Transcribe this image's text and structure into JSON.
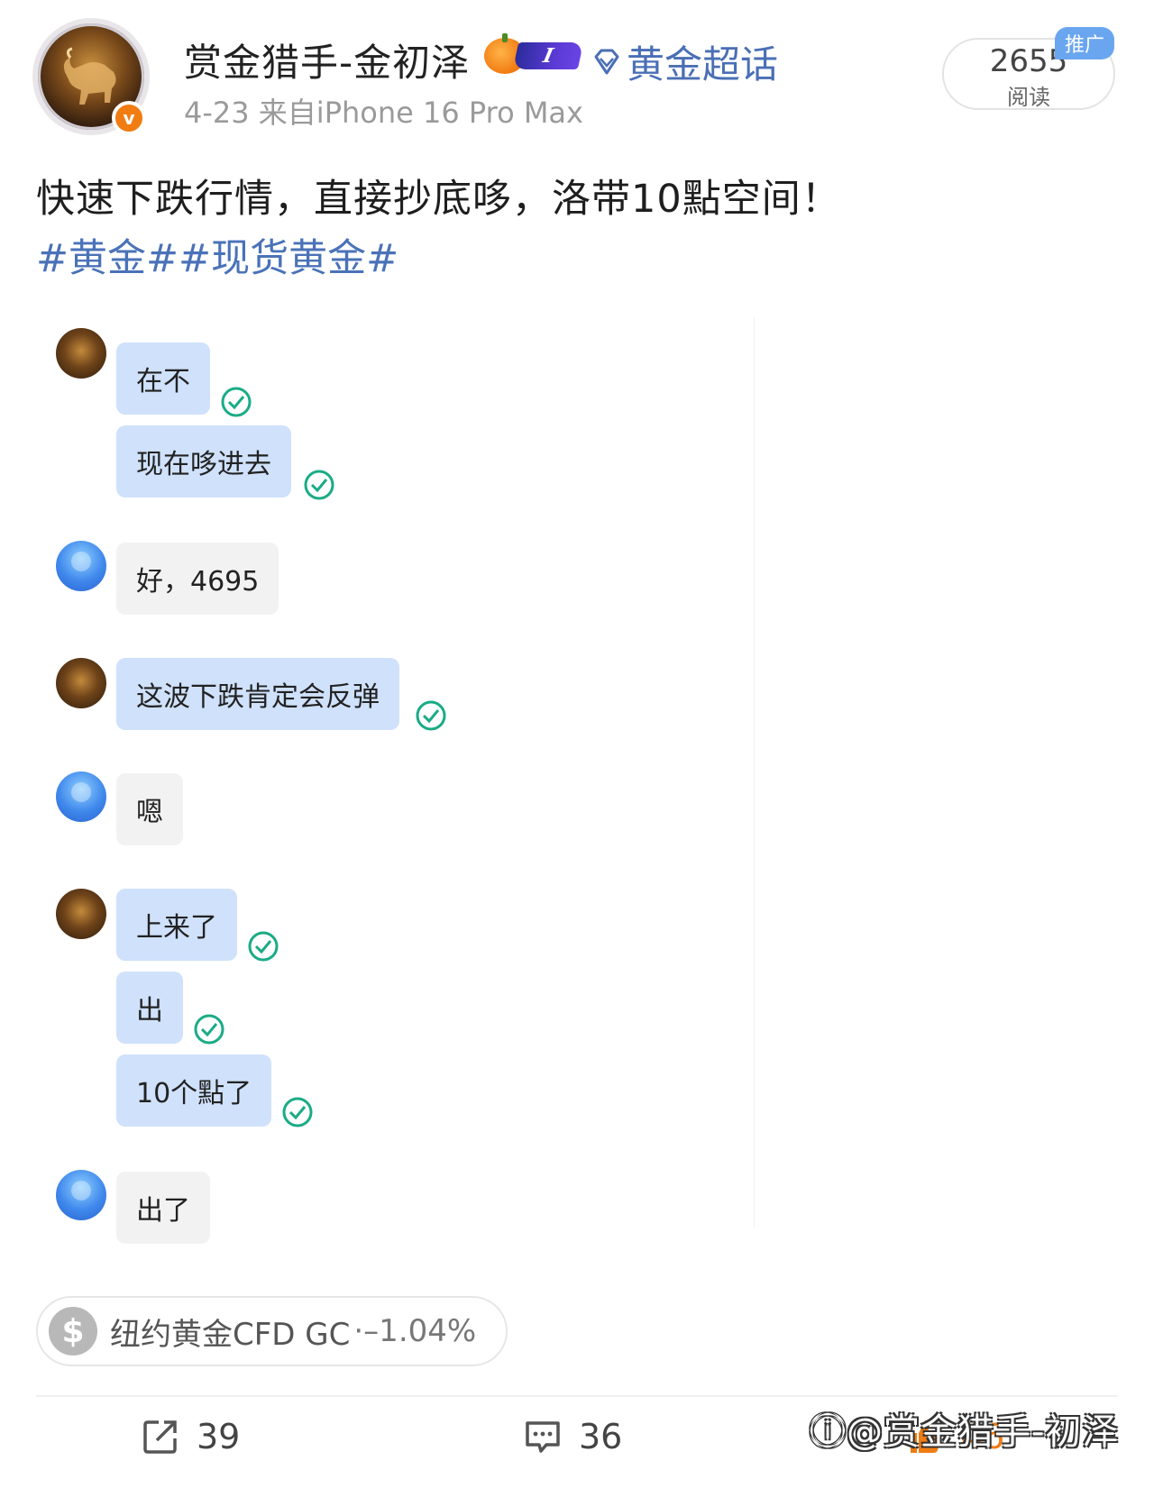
{
  "post": {
    "username": "赏金猎手-金初泽",
    "level_badge": "I",
    "supertopic": "黄金超话",
    "meta": "4-23  来自iPhone 16 Pro Max",
    "reads_count": "2655",
    "reads_label": "阅读",
    "promo_tag": "推广",
    "text": "快速下跌行情，直接抄底哆，洛带10點空间！",
    "tags": "#黄金##现货黄金#"
  },
  "chat": {
    "messages": [
      {
        "sender": "me",
        "text": "在不"
      },
      {
        "sender": "me",
        "text": "现在哆进去"
      },
      {
        "sender": "other",
        "text": "好，4695"
      },
      {
        "sender": "me",
        "text": "这波下跌肯定会反弹"
      },
      {
        "sender": "other",
        "text": "嗯"
      },
      {
        "sender": "me",
        "text": "上来了"
      },
      {
        "sender": "me",
        "text": "出"
      },
      {
        "sender": "me",
        "text": "10个點了"
      },
      {
        "sender": "other",
        "text": "出了"
      }
    ]
  },
  "stock": {
    "symbol": "$",
    "name": "纽约黄金CFD GC",
    "change": "·–1.04%"
  },
  "actions": {
    "repost_count": "39",
    "comment_count": "36",
    "like_count": "46"
  },
  "watermark": "ⓘ@赏金猎手-初泽",
  "colors": {
    "brand_orange": "#f07c12",
    "topic_blue": "#4a72b8",
    "my_bubble": "#cfe1fb",
    "other_bubble": "#f2f2f2",
    "read_check": "#1aab86"
  }
}
